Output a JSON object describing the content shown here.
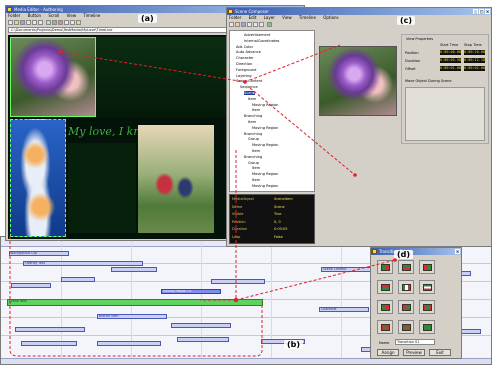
{
  "labels": {
    "a": "(a)",
    "b": "(b)",
    "c": "(c)",
    "d": "(d)"
  },
  "win_a": {
    "title": "Media Editor - Authoring",
    "menu": [
      "Folder",
      "Button",
      "Scroll",
      "View",
      "Timeline"
    ],
    "address": "C:\\Documents\\Projects\\Demo\\TestMedia\\MyLove\\TimeLine",
    "overlay_text": "My love, I know"
  },
  "win_c": {
    "title": "Scene Composer",
    "menu": [
      "Folder",
      "Edit",
      "Layer",
      "View",
      "Timeline",
      "Options"
    ],
    "preview_title": "View Properties",
    "readout_headers": [
      "Start Time",
      "Stop Time"
    ],
    "readouts": [
      {
        "label": "Position",
        "start": "0:00:00.00",
        "stop": "0:00:10.00"
      },
      {
        "label": "Duration",
        "start": "0:00:05.50",
        "stop": "0:00:12.10"
      },
      {
        "label": "Offset",
        "start": "0:00:01.00",
        "stop": "0:00:02.00"
      }
    ],
    "transform_title": "Move Object During Scene",
    "tree": [
      {
        "t": "Advertisement",
        "d": 3
      },
      {
        "t": "InternalCoordinates",
        "d": 3
      },
      {
        "t": "Ads Color",
        "d": 1
      },
      {
        "t": "Auto Advance",
        "d": 1
      },
      {
        "t": "Character",
        "d": 1
      },
      {
        "t": "Direction",
        "d": 1
      },
      {
        "t": "Foreground",
        "d": 1
      },
      {
        "t": "Layering",
        "d": 1
      },
      {
        "t": "Scene Content",
        "d": 1
      },
      {
        "t": "Sequence",
        "d": 2
      },
      {
        "t": "Scene",
        "d": 3,
        "sel": true
      },
      {
        "t": "Item",
        "d": 4
      },
      {
        "t": "Moving Region",
        "d": 5
      },
      {
        "t": "Item",
        "d": 5
      },
      {
        "t": "Branching",
        "d": 3
      },
      {
        "t": "Item",
        "d": 4
      },
      {
        "t": "Moving Region",
        "d": 5
      },
      {
        "t": "Branching",
        "d": 3
      },
      {
        "t": "Group",
        "d": 4
      },
      {
        "t": "Moving Region",
        "d": 5
      },
      {
        "t": "Item",
        "d": 5
      },
      {
        "t": "Branching",
        "d": 3
      },
      {
        "t": "Group",
        "d": 4
      },
      {
        "t": "Item",
        "d": 5
      },
      {
        "t": "Moving Region",
        "d": 5
      },
      {
        "t": "Item",
        "d": 5
      },
      {
        "t": "Moving Region",
        "d": 5
      }
    ],
    "props": [
      {
        "k": "MediaObject",
        "v": "SceneItem"
      },
      {
        "k": "Name",
        "v": "Scene"
      },
      {
        "k": "Visible",
        "v": "True"
      },
      {
        "k": "Position",
        "v": "0, 0"
      },
      {
        "k": "Duration",
        "v": "0:00:05"
      },
      {
        "k": "Loop",
        "v": "False"
      }
    ]
  },
  "win_d": {
    "title": "Transition Palette",
    "name_label": "Name",
    "name_value": "Transition 01",
    "buttons": [
      "Assign",
      "Preview",
      "Exit"
    ]
  },
  "timeline": {
    "tracks": [
      "Background",
      "Overlay Text",
      "Scene 1",
      "Branch",
      "Moving Region",
      "Character",
      "Foreground"
    ],
    "bars": [
      {
        "label": "Background Clip",
        "kind": "plain"
      },
      {
        "label": "Overlay Text",
        "kind": "plain"
      },
      {
        "label": "Scene Item",
        "kind": "green"
      },
      {
        "label": "Moving Region 01",
        "kind": "blue"
      },
      {
        "label": "Branch Item",
        "kind": "plain"
      },
      {
        "label": "Scene Content",
        "kind": "plain"
      },
      {
        "label": "Character",
        "kind": "plain"
      },
      {
        "label": "Foreground Clip",
        "kind": "plain"
      }
    ]
  },
  "colors": {
    "accent": "#1f3d9a",
    "timeline_green": "#5fd35f",
    "timeline_blue": "#7e8cf0",
    "annotation": "#e0202a"
  }
}
